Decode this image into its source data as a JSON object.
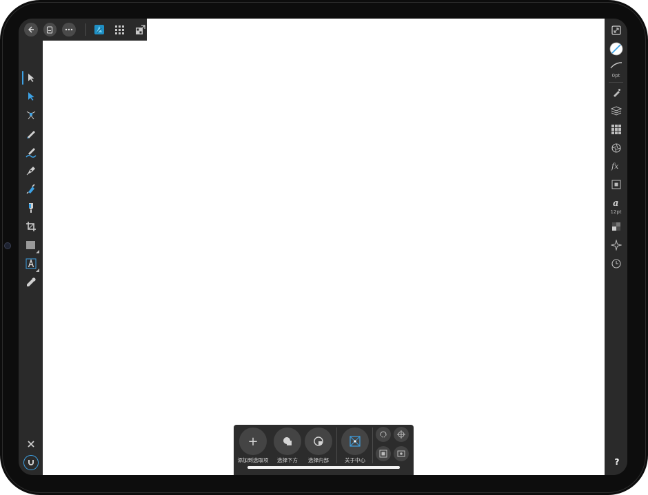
{
  "topbar": {
    "back_icon": "back-arrow-icon",
    "document_icon": "document-icon",
    "more_icon": "more-icon",
    "persona_designer_icon": "designer-persona-icon",
    "persona_pixel_icon": "pixel-persona-icon",
    "persona_export_icon": "export-persona-icon"
  },
  "tools": [
    {
      "name": "move-tool-icon",
      "active": true
    },
    {
      "name": "node-tool-icon"
    },
    {
      "name": "transform-tool-icon"
    },
    {
      "name": "pencil-tool-icon"
    },
    {
      "name": "vector-brush-tool-icon"
    },
    {
      "name": "pen-tool-icon"
    },
    {
      "name": "fill-tool-icon"
    },
    {
      "name": "transparency-tool-icon"
    },
    {
      "name": "crop-tool-icon"
    },
    {
      "name": "rectangle-tool-icon"
    },
    {
      "name": "artistic-text-tool-icon"
    },
    {
      "name": "color-picker-tool-icon"
    }
  ],
  "right_panel": {
    "stroke_width_label": "0pt",
    "font_size_label": "12pt",
    "help_label": "?"
  },
  "context_toolbar": {
    "add_plus": "+",
    "add_to_selection": "添加到选取项",
    "select_below": "选择下方",
    "select_inside": "选择内部",
    "about_center": "关于中心"
  },
  "colors": {
    "accent": "#3da2e5",
    "panel": "#2a2a2a",
    "bezel": "#0d0d0d",
    "canvas": "#ffffff"
  }
}
